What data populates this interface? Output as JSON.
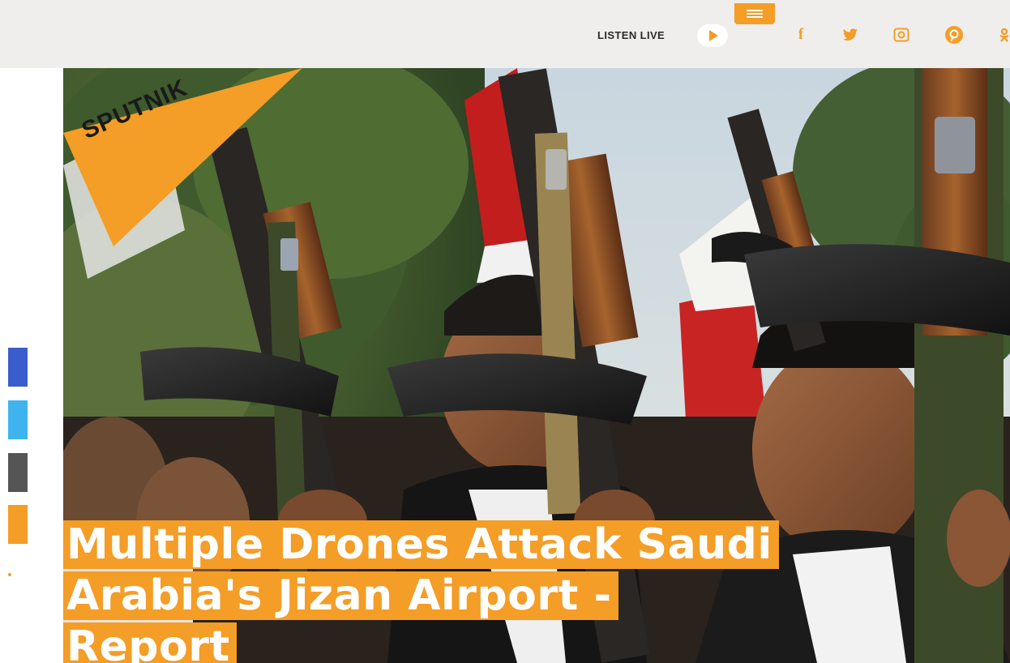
{
  "header": {
    "listen_live_label": "LISTEN LIVE",
    "menu_icon": "hamburger-menu-icon",
    "play_icon": "play-icon",
    "social_icons": [
      "facebook-icon",
      "twitter-icon",
      "instagram-icon",
      "pinterest-icon",
      "odnoklassniki-icon"
    ],
    "facebook_glyph": "f"
  },
  "logo": {
    "text": "SPUTNIK"
  },
  "share_rail": {
    "items": [
      "facebook-share",
      "twitter-share",
      "email-share",
      "more-share"
    ]
  },
  "article": {
    "headline_lines": [
      "Multiple Drones Attack Saudi",
      "Arabia's Jizan Airport -",
      "Report"
    ]
  },
  "colors": {
    "brand_orange": "#f49d27",
    "topbar_bg": "#efeeec",
    "facebook_blue": "#3b5ccc",
    "twitter_blue": "#3fb3ee",
    "mail_gray": "#555555"
  }
}
